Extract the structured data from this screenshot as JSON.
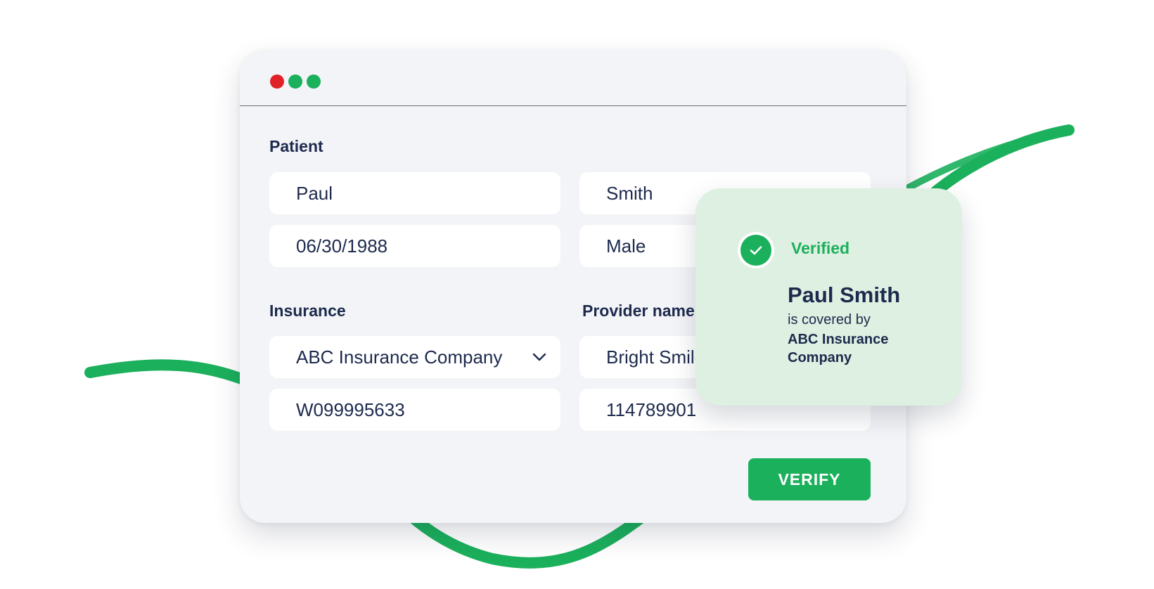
{
  "window": {
    "controls": [
      "close",
      "minimize",
      "maximize"
    ]
  },
  "patient": {
    "section_label": "Patient",
    "first_name": "Paul",
    "last_name": "Smith",
    "dob": "06/30/1988",
    "sex": "Male"
  },
  "insurance": {
    "section_label": "Insurance",
    "company": "ABC Insurance Company",
    "member_id": "W099995633"
  },
  "provider": {
    "section_label": "Provider name",
    "name": "Bright Smile",
    "npi": "114789901"
  },
  "actions": {
    "verify_label": "VERIFY"
  },
  "result_card": {
    "status": "Verified",
    "patient_name": "Paul Smith",
    "coverage_text": "is covered by",
    "company": "ABC Insurance Company"
  },
  "icons": {
    "status": "check-circle-icon",
    "dropdown": "chevron-down-icon"
  },
  "colors": {
    "accent_green": "#1bb05c",
    "navy_text": "#1d2a4d",
    "close_red": "#e02128",
    "card_bg": "#def0e1",
    "window_bg": "#f3f4f7"
  }
}
